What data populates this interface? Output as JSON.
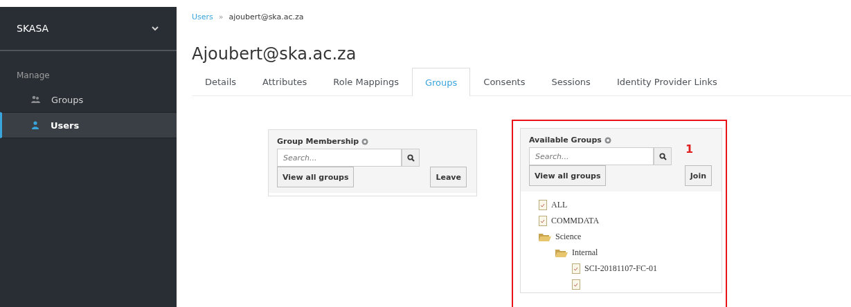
{
  "sidebar": {
    "realm": "SKASA",
    "section": "Manage",
    "items": [
      {
        "label": "Groups",
        "kind": "groups",
        "selected": false
      },
      {
        "label": "Users",
        "kind": "user",
        "selected": true
      }
    ]
  },
  "breadcrumb": {
    "link": "Users",
    "separator": "»",
    "current": "ajoubert@ska.ac.za"
  },
  "title": "Ajoubert@ska.ac.za",
  "tabs": [
    {
      "label": "Details",
      "selected": false
    },
    {
      "label": "Attributes",
      "selected": false
    },
    {
      "label": "Role Mappings",
      "selected": false
    },
    {
      "label": "Groups",
      "selected": true
    },
    {
      "label": "Consents",
      "selected": false
    },
    {
      "label": "Sessions",
      "selected": false
    },
    {
      "label": "Identity Provider Links",
      "selected": false
    }
  ],
  "membership": {
    "title": "Group Membership",
    "search": {
      "placeholder": "Search..."
    },
    "view_all": "View all groups",
    "action": "Leave"
  },
  "available": {
    "title": "Available Groups",
    "annotation": "1",
    "search": {
      "placeholder": "Search..."
    },
    "view_all": "View all groups",
    "action": "Join",
    "tree": [
      {
        "label": "ALL",
        "kind": "file"
      },
      {
        "label": "COMMDATA",
        "kind": "file"
      },
      {
        "label": "Science",
        "kind": "folder",
        "children": [
          {
            "label": "Internal",
            "kind": "folder",
            "children": [
              {
                "label": "SCI-20181107-FC-01",
                "kind": "file"
              },
              {
                "kind": "file"
              }
            ]
          }
        ]
      }
    ]
  }
}
